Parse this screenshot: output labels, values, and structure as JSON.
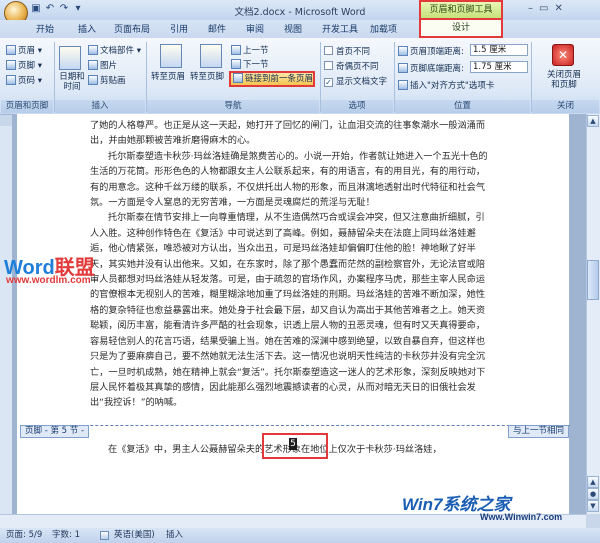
{
  "window": {
    "title": "文档2.docx - Microsoft Word",
    "context_tool_title": "页眉和页脚工具"
  },
  "tabs": [
    "开始",
    "插入",
    "页面布局",
    "引用",
    "邮件",
    "审阅",
    "视图",
    "开发工具",
    "加载项"
  ],
  "context_tab": "设计",
  "ribbon": {
    "groups": {
      "header_footer": {
        "label": "页眉和页脚",
        "items": [
          "页眉",
          "页脚",
          "页码"
        ]
      },
      "insert": {
        "label": "插入",
        "datetime": "日期和\n时间",
        "items": [
          "文档部件",
          "图片",
          "剪贴画"
        ]
      },
      "nav": {
        "label": "导航",
        "goto_header": "转至页眉",
        "goto_footer": "转至页脚",
        "prev": "上一节",
        "next": "下一节",
        "link_prev": "链接到前一条页眉"
      },
      "options": {
        "label": "选项",
        "items": [
          {
            "label": "首页不同",
            "checked": false
          },
          {
            "label": "奇偶页不同",
            "checked": false
          },
          {
            "label": "显示文档文字",
            "checked": true
          }
        ]
      },
      "position": {
        "label": "位置",
        "header_top_label": "页眉顶端距离:",
        "header_top_value": "1.5 厘米",
        "footer_bottom_label": "页脚底端距离:",
        "footer_bottom_value": "1.75 厘米",
        "align_tab": "插入\"对齐方式\"选项卡"
      },
      "close": {
        "label": "关闭",
        "button": "关闭页眉\n和页脚"
      }
    }
  },
  "document": {
    "paragraphs": [
      "了她的人格尊严。也正是从这一天起，她打开了回忆的闸门，让血泪交流的往事象潮水一般汹涌而出，并由她那颗被苦难折磨得麻木的心。",
      "托尔斯泰塑造卡秋莎·玛丝洛娃确是煞费苦心的。小说一开始，作者就让她进入一个五光十色的生活的万花筒。形形色色的人物都跟女主人公联系起来，有的用语言，有的用目光，有的用行动，有的用意念。这种千丝万缕的联系，不仅烘托出人物的形象，而且淋漓地透射出时代特征和社会气氛。一方面是令人窒息的无穷苦难，一方面是灵魂腐烂的荒淫与无耻！",
      "托尔斯泰在情节安排上一向尊重情理，从不生造偶然巧合或误会冲突，但又注意曲折细腻，引人入胜。这种创作特色在《复活》中可说达到了高峰。例如，聂赫留朵夫在法庭上同玛丝洛娃邂逅，他心情紧张，唯恐被对方认出，当众出丑，可是玛丝洛娃却偏偏盯住他的脸！神地瞅了好半天，其实她并没有认出他来。又如，在东家时，除了那个愚蠢而茫然的副检察官外，无论法官或陪审人员都想对玛丝洛娃从轻发落。可是，由于疏忽的官场作风，办案程序马虎，那些主宰人民命运的官僚根本无视别人的苦难，糊里糊涂地加重了玛丝洛娃的刑期。玛丝洛娃的苦难不断加深，她性格的复杂特征也愈益暴露出来。她处身于社会最下层，却又自认为高出于其他苦难者之上。她天资聪颖，阅历丰富，能看清许多严酷的社会现象，识透上层人物的丑恶灵魂，但有时又天真得要命，容易轻信别人的花言巧语，结果受骗上当。她在苦难的深渊中感到绝望，以致自暴自弃，但这样也只是为了要麻痹自己，要不然她就无法生活下去。这一情况也说明天性纯洁的卡秋莎并没有完全沉亡，一旦时机成熟，她在精神上就会“复活”。托尔斯泰塑造这一迷人的艺术形象，深刻反映她对下层人民怀着极其真挚的感情，因此能那么强烈地震撼读者的心灵，从而对暗无天日的旧俄社会发出“我控诉！”的呐喊。",
      "在《复活》中，男主人公聂赫留朵夫的艺术形象在地位上仅次于卡秋莎·玛丝洛娃，"
    ]
  },
  "footer": {
    "tab_label": "页脚 - 第 5 节 -",
    "same_as_previous": "与上一节相同",
    "page_number": "5"
  },
  "statusbar": {
    "page": "页面: 5/9",
    "words": "字数: 1",
    "language": "英语(美国)",
    "mode": "插入"
  },
  "watermarks": {
    "left_logo_a": "Word",
    "left_logo_b": "联盟",
    "left_url": "www.wordlm.com",
    "right_logo": "Win7系统之家",
    "right_url": "Www.Winwin7.com"
  },
  "colors": {
    "highlight": "#e23a3a",
    "context_tab": "#c6e27a",
    "ribbon": "#dde8f6"
  }
}
